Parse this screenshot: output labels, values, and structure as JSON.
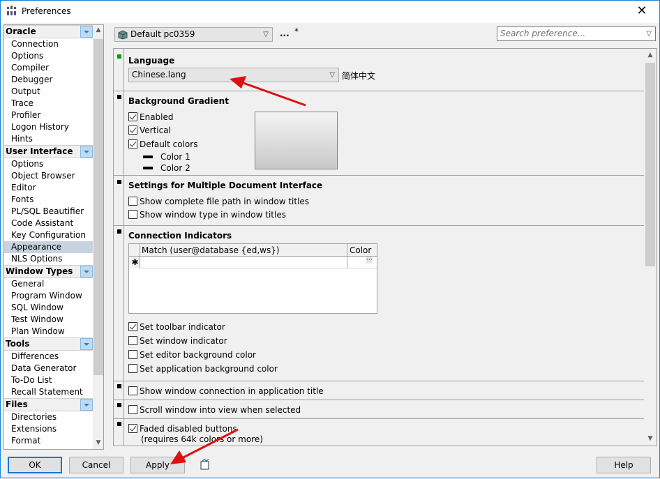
{
  "window": {
    "title": "Preferences",
    "close_icon": "close-icon"
  },
  "sidebar": {
    "groups": [
      {
        "label": "Oracle",
        "items": [
          "Connection",
          "Options",
          "Compiler",
          "Debugger",
          "Output",
          "Trace",
          "Profiler",
          "Logon History",
          "Hints"
        ]
      },
      {
        "label": "User Interface",
        "items": [
          "Options",
          "Object Browser",
          "Editor",
          "Fonts",
          "PL/SQL Beautifier",
          "Code Assistant",
          "Key Configuration",
          "Appearance",
          "NLS Options"
        ]
      },
      {
        "label": "Window Types",
        "items": [
          "General",
          "Program Window",
          "SQL Window",
          "Test Window",
          "Plan Window"
        ]
      },
      {
        "label": "Tools",
        "items": [
          "Differences",
          "Data Generator",
          "To-Do List",
          "Recall Statement"
        ]
      },
      {
        "label": "Files",
        "items": [
          "Directories",
          "Extensions",
          "Format"
        ]
      }
    ],
    "selected": "Appearance"
  },
  "toolbar": {
    "profile": "Default pc0359",
    "more": "...",
    "modified": "*",
    "search_placeholder": "Search preference..."
  },
  "language": {
    "heading": "Language",
    "value": "Chinese.lang",
    "native": "简体中文",
    "marker_color": "#00a000"
  },
  "gradient": {
    "heading": "Background Gradient",
    "options": [
      {
        "label": "Enabled",
        "checked": true
      },
      {
        "label": "Vertical",
        "checked": true
      },
      {
        "label": "Default colors",
        "checked": true
      }
    ],
    "color1": "Color 1",
    "color2": "Color 2"
  },
  "mdi": {
    "heading": "Settings for Multiple Document Interface",
    "options": [
      {
        "label": "Show complete file path in window titles",
        "checked": false
      },
      {
        "label": "Show window type in window titles",
        "checked": false
      }
    ]
  },
  "conn": {
    "heading": "Connection Indicators",
    "col_match": "Match (user@database {ed,ws})",
    "col_color": "Color",
    "new_row": "✱",
    "ellipsis": "···",
    "options": [
      {
        "label": "Set toolbar indicator",
        "checked": true
      },
      {
        "label": "Set window indicator",
        "checked": false
      },
      {
        "label": "Set editor background color",
        "checked": false
      },
      {
        "label": "Set application background color",
        "checked": false
      }
    ]
  },
  "misc": [
    {
      "label": "Show window connection in application title",
      "checked": false
    },
    {
      "label": "Scroll window into view when selected",
      "checked": false
    },
    {
      "label": "Faded disabled buttons",
      "checked": true
    }
  ],
  "faded_note": "(requires 64k colors or more)",
  "buttons": {
    "ok": "OK",
    "cancel": "Cancel",
    "apply": "Apply",
    "help": "Help"
  }
}
